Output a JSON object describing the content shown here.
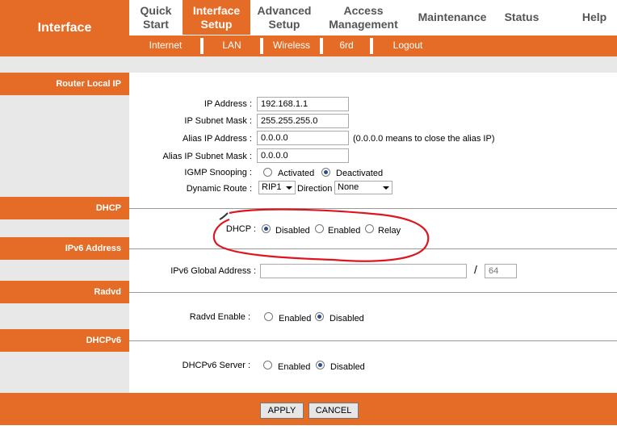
{
  "brand": "Interface",
  "nav": {
    "tabs": [
      "Quick Start",
      "Interface Setup",
      "Advanced Setup",
      "Access Management",
      "Maintenance",
      "Status",
      "Help"
    ],
    "tab_lines": [
      [
        "Quick",
        "Start"
      ],
      [
        "Interface",
        "Setup"
      ],
      [
        "Advanced",
        "Setup"
      ],
      [
        "Access",
        "Management"
      ],
      [
        "Maintenance"
      ],
      [
        "Status"
      ],
      [
        "Help"
      ]
    ],
    "active": "Interface Setup"
  },
  "subnav": {
    "items": [
      "Internet",
      "LAN",
      "Wireless",
      "6rd",
      "Logout"
    ],
    "active": "LAN"
  },
  "sections": {
    "router_local_ip": "Router Local IP",
    "dhcp": "DHCP",
    "ipv6_address": "IPv6 Address",
    "radvd": "Radvd",
    "dhcpv6": "DHCPv6"
  },
  "router": {
    "ip_label": "IP Address :",
    "ip_value": "192.168.1.1",
    "mask_label": "IP Subnet Mask :",
    "mask_value": "255.255.255.0",
    "alias_label": "Alias IP Address :",
    "alias_value": "0.0.0.0",
    "alias_note": "(0.0.0.0 means to close the alias IP)",
    "alias_mask_label": "Alias IP Subnet Mask :",
    "alias_mask_value": "0.0.0.0",
    "igmp_label": "IGMP Snooping :",
    "igmp_options": [
      "Activated",
      "Deactivated"
    ],
    "igmp_selected": "Deactivated",
    "route_label": "Dynamic Route :",
    "route_value": "RIP1",
    "direction_label": "Direction",
    "direction_value": "None"
  },
  "dhcp": {
    "label": "DHCP :",
    "options": [
      "Disabled",
      "Enabled",
      "Relay"
    ],
    "selected": "Disabled"
  },
  "ipv6": {
    "label": "IPv6 Global Address :",
    "value": "",
    "separator": "/",
    "prefix_placeholder": "64"
  },
  "radvd": {
    "label": "Radvd Enable :",
    "options": [
      "Enabled",
      "Disabled"
    ],
    "selected": "Disabled"
  },
  "dhcpv6": {
    "label": "DHCPv6 Server :",
    "options": [
      "Enabled",
      "Disabled"
    ],
    "selected": "Disabled"
  },
  "buttons": {
    "apply": "APPLY",
    "cancel": "CANCEL"
  },
  "colors": {
    "accent": "#e46c27",
    "sidebar": "#e8e8e8",
    "annotation": "#e0141e"
  }
}
